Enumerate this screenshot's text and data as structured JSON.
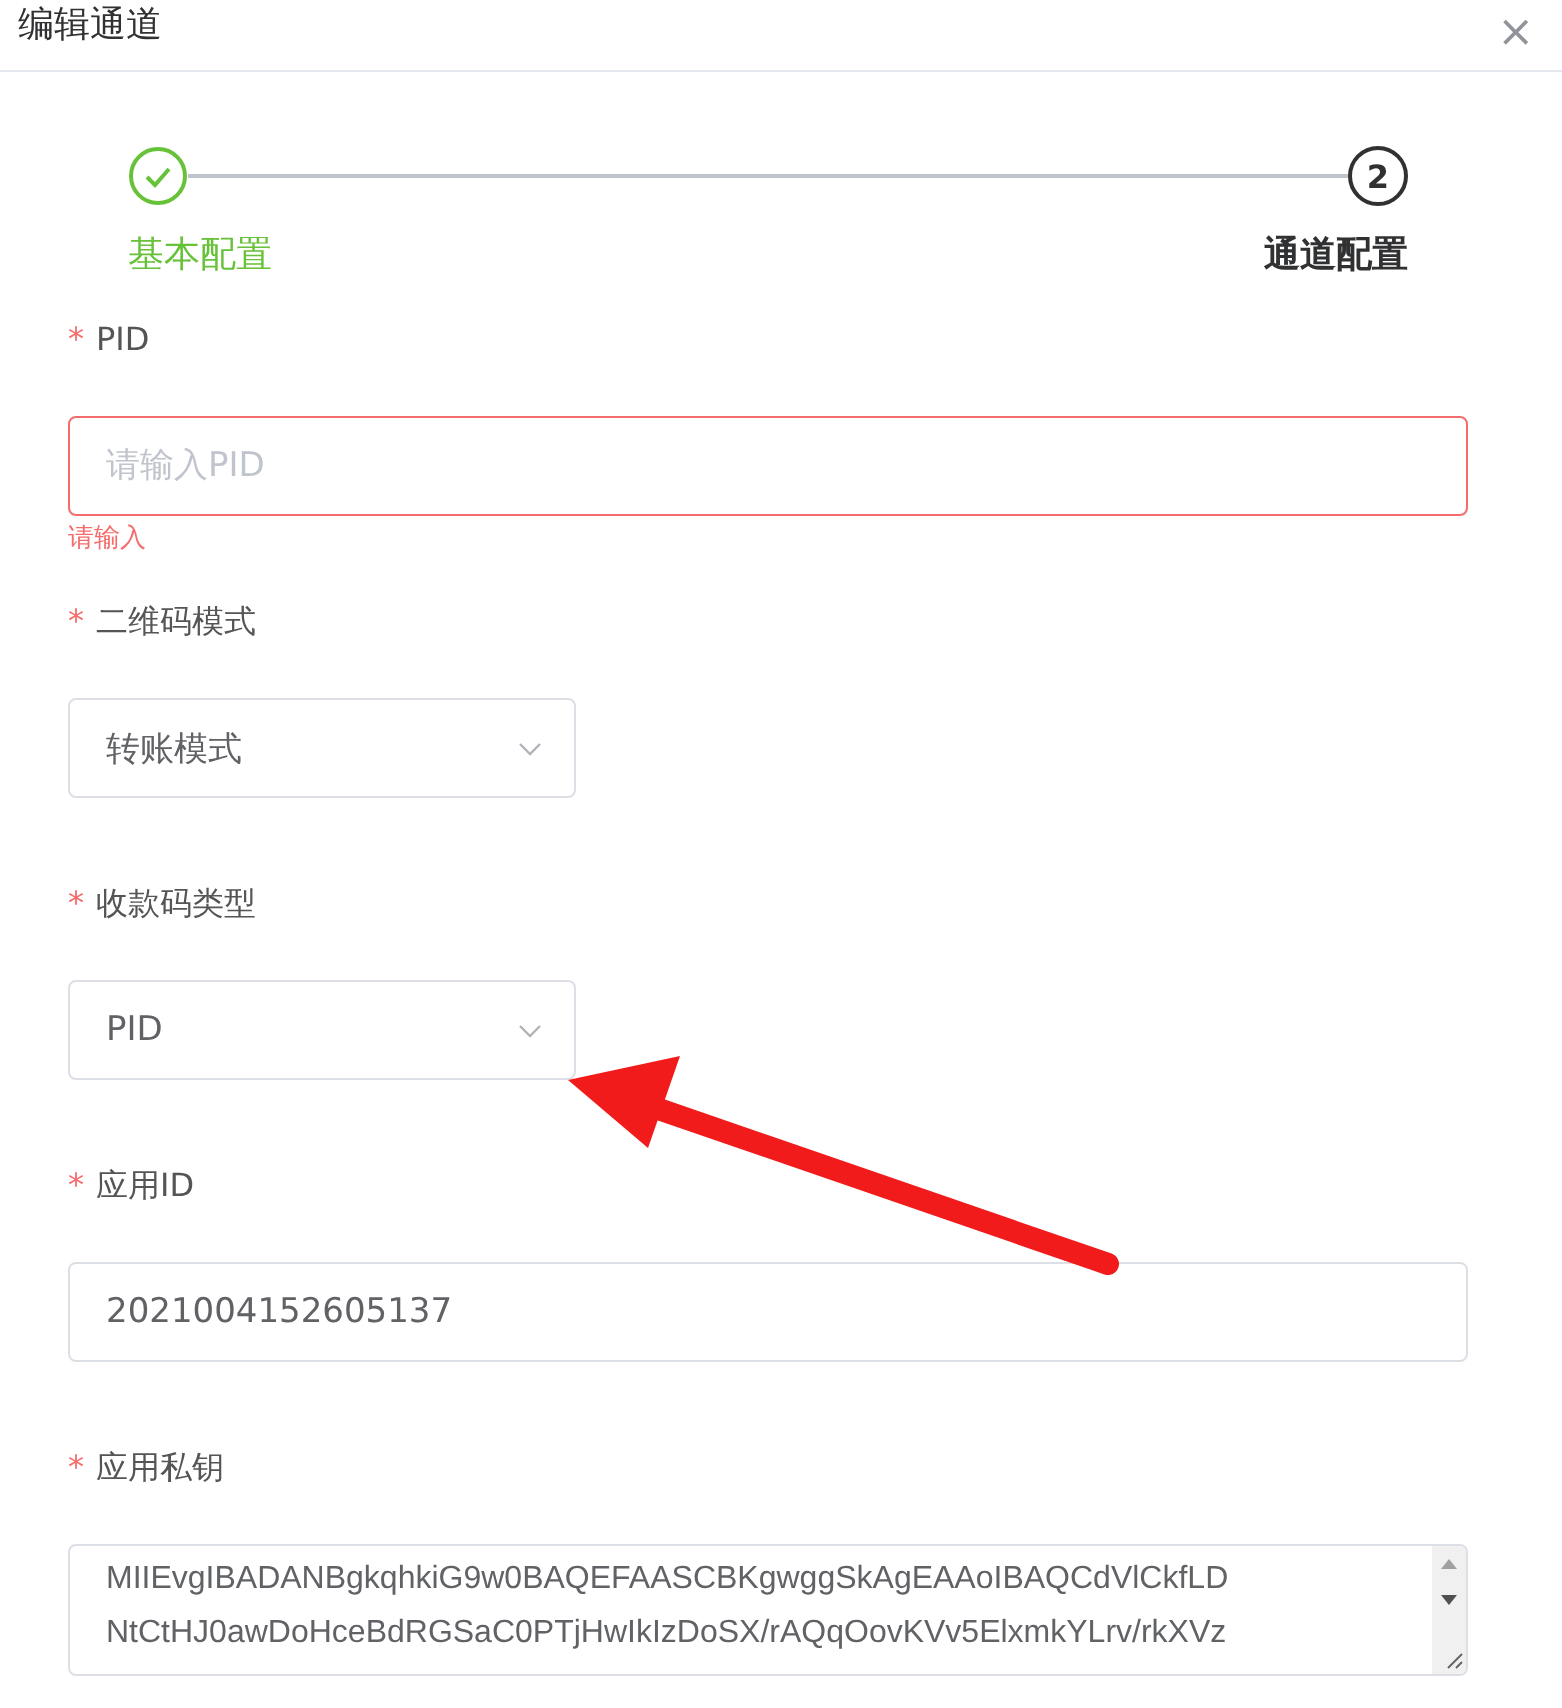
{
  "dialog": {
    "title": "编辑通道",
    "close": "×"
  },
  "steps": [
    {
      "label": "基本配置",
      "done": true,
      "selected": false
    },
    {
      "label": "通道配置",
      "number": "2",
      "done": false,
      "selected": true
    }
  ],
  "fields": [
    {
      "kind": "input",
      "label": "PID",
      "required_mark": "*",
      "placeholder": "请输入PID",
      "error": "请输入"
    },
    {
      "kind": "select",
      "label": "二维码模式",
      "required_mark": "*",
      "value": "转账模式"
    },
    {
      "kind": "select",
      "label": "收款码类型",
      "required_mark": "*",
      "value": "PID"
    },
    {
      "kind": "input",
      "label": "应用ID",
      "required_mark": "*",
      "value": "2021004152605137"
    },
    {
      "kind": "textarea",
      "label": "应用私钥",
      "required_mark": "*",
      "value": "MIIEvgIBADANBgkqhkiG9w0BAQEFAASCBKgwggSkAgEAAoIBAQCdVlCkfLD\nNtCtHJ0awDoHceBdRGSaC0PTjHwIkIzDoSX/rAQqOovKVv5ElxmkYLrv/rkXVz"
    }
  ]
}
